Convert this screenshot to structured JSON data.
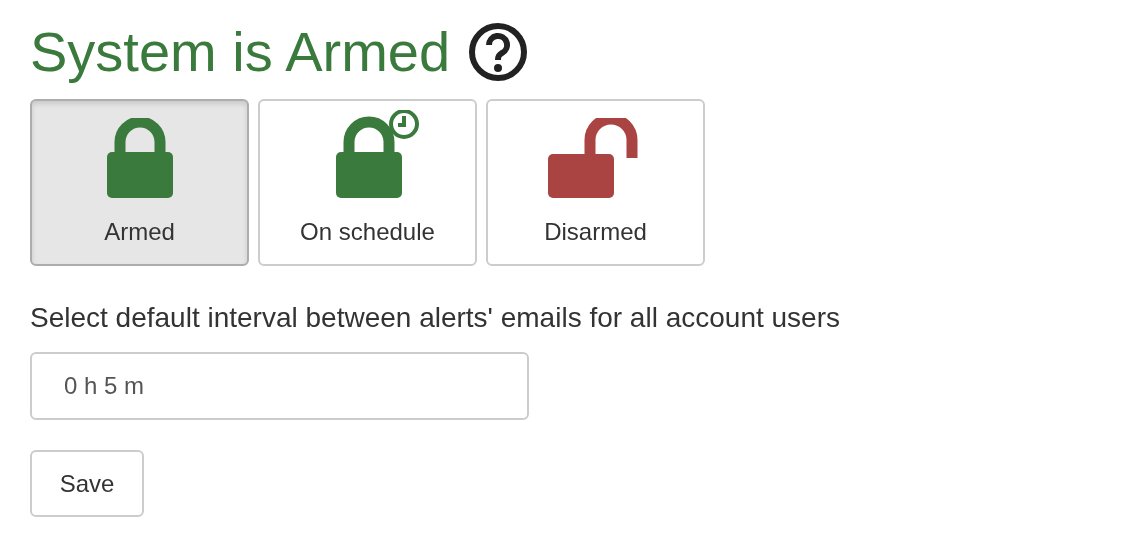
{
  "title": "System is Armed",
  "modes": [
    {
      "label": "Armed",
      "kind": "armed",
      "selected": true
    },
    {
      "label": "On schedule",
      "kind": "schedule",
      "selected": false
    },
    {
      "label": "Disarmed",
      "kind": "disarmed",
      "selected": false
    }
  ],
  "interval": {
    "label": "Select default interval between alerts' emails for all account users",
    "value": "0 h 5 m"
  },
  "buttons": [
    "Save"
  ]
}
